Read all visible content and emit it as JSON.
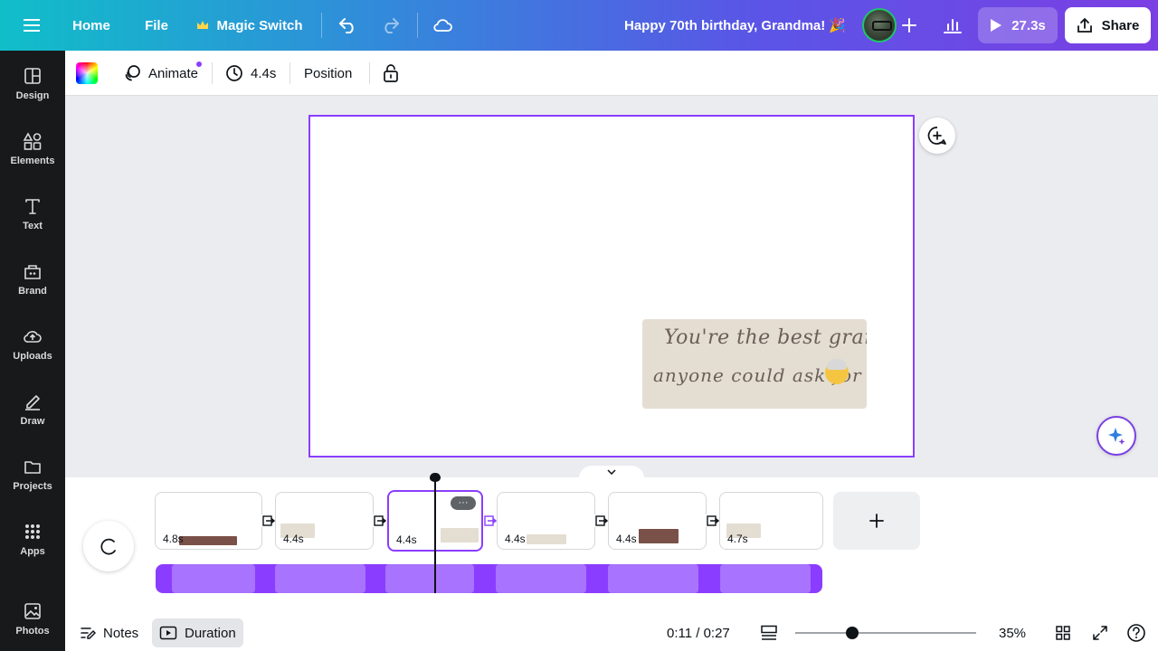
{
  "topbar": {
    "home_label": "Home",
    "file_label": "File",
    "magic_switch_label": "Magic Switch",
    "title": "Happy 70th birthday, Grandma! 🎉",
    "play_label": "27.3s",
    "share_label": "Share"
  },
  "sidebar": {
    "items": [
      {
        "label": "Design",
        "icon": "design-icon"
      },
      {
        "label": "Elements",
        "icon": "elements-icon"
      },
      {
        "label": "Text",
        "icon": "text-icon"
      },
      {
        "label": "Brand",
        "icon": "brand-icon"
      },
      {
        "label": "Uploads",
        "icon": "uploads-icon"
      },
      {
        "label": "Draw",
        "icon": "draw-icon"
      },
      {
        "label": "Projects",
        "icon": "projects-icon"
      },
      {
        "label": "Apps",
        "icon": "apps-icon"
      },
      {
        "label": "Photos",
        "icon": "photos-icon"
      }
    ]
  },
  "toolbar": {
    "animate_label": "Animate",
    "duration_label": "4.4s",
    "position_label": "Position"
  },
  "canvas": {
    "text_line1": "You're the best grandma",
    "text_line2": "anyone could ask for"
  },
  "timeline": {
    "scenes": [
      {
        "duration": "4.8s"
      },
      {
        "duration": "4.4s"
      },
      {
        "duration": "4.4s"
      },
      {
        "duration": "4.4s"
      },
      {
        "duration": "4.4s"
      },
      {
        "duration": "4.7s"
      }
    ],
    "more_label": "···"
  },
  "footer": {
    "notes_label": "Notes",
    "duration_label": "Duration",
    "time_readout": "0:11 / 0:27",
    "zoom_label": "35%"
  },
  "colors": {
    "accent": "#8b3dff",
    "sidebar_bg": "#18191b",
    "textbox_bg": "#e4ddd2"
  }
}
